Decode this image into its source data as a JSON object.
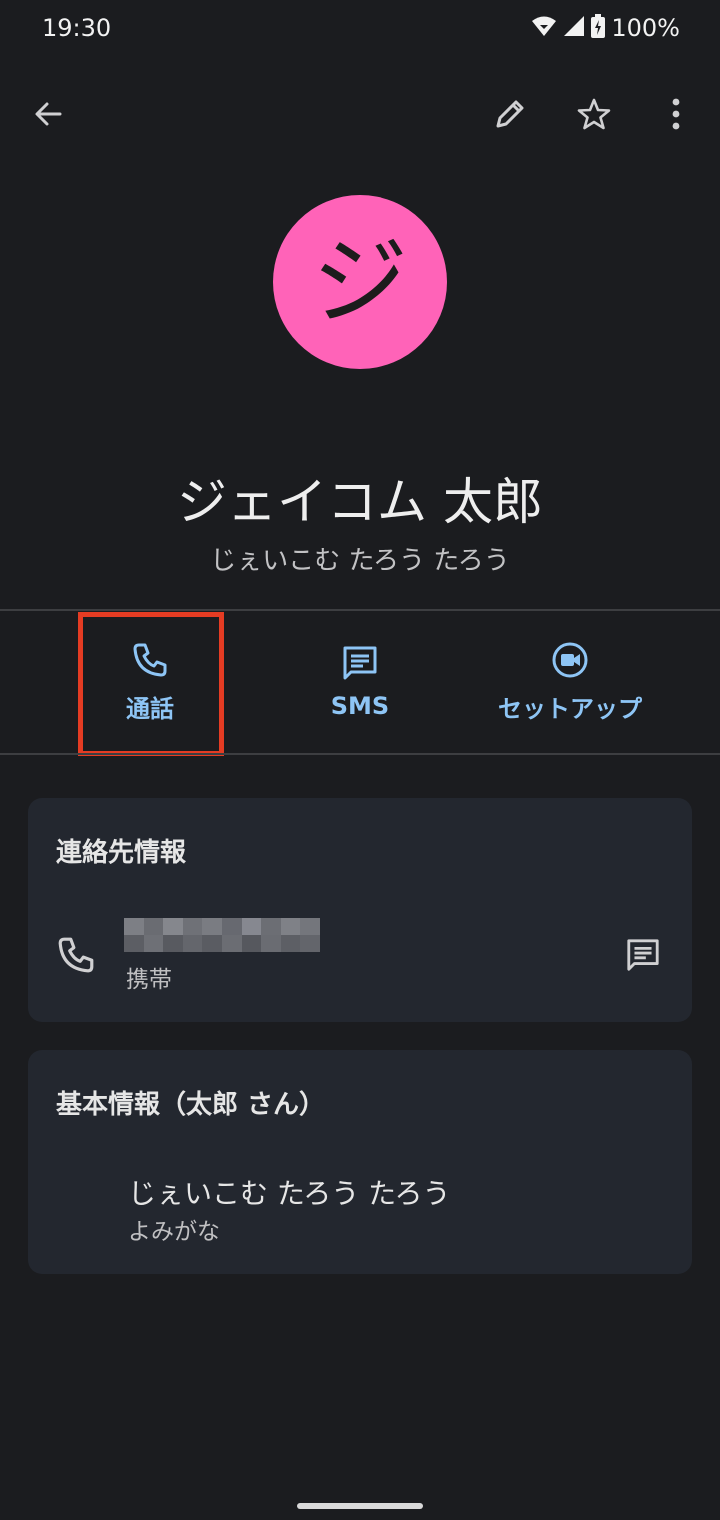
{
  "status_bar": {
    "time": "19:30",
    "battery": "100%"
  },
  "toolbar": {
    "back_icon": "arrow-left-icon",
    "edit_icon": "pencil-icon",
    "star_icon": "star-outline-icon",
    "more_icon": "more-vert-icon"
  },
  "contact": {
    "avatar_letter": "ジ",
    "avatar_color": "#ff63b8",
    "name": "ジェイコム 太郎",
    "phonetic": "じぇいこむ たろう たろう"
  },
  "actions": {
    "call_label": "通話",
    "sms_label": "SMS",
    "setup_label": "セットアップ",
    "accent_color": "#8ec5f5",
    "highlight_color": "#e53c23"
  },
  "contact_info": {
    "title": "連絡先情報",
    "phone_type": "携帯"
  },
  "basic_info": {
    "title": "基本情報（太郎 さん）",
    "reading_value": "じぇいこむ たろう たろう",
    "reading_label": "よみがな"
  }
}
